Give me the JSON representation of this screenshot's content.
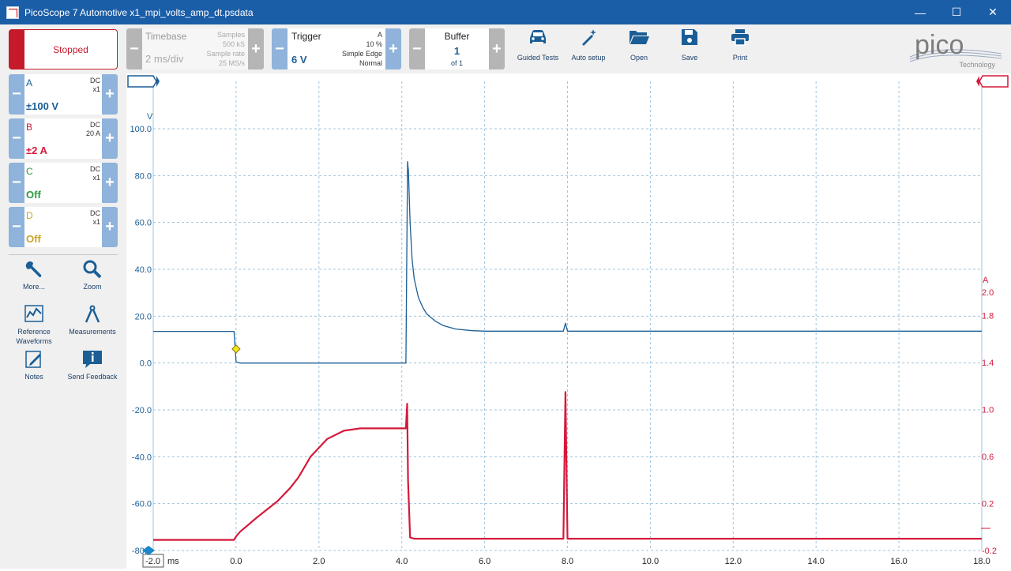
{
  "window": {
    "title": "PicoScope 7 Automotive x1_mpi_volts_amp_dt.psdata",
    "minimize": "—",
    "maximize": "☐",
    "close": "✕"
  },
  "run": {
    "status": "Stopped"
  },
  "timebase": {
    "label": "Timebase",
    "value": "2 ms/div",
    "samples_label": "Samples",
    "samples_value": "500 kS",
    "rate_label": "Sample rate",
    "rate_value": "25 MS/s"
  },
  "trigger": {
    "label": "Trigger",
    "value": "6 V",
    "channel": "A",
    "percent": "10 %",
    "type": "Simple Edge",
    "mode": "Normal"
  },
  "buffer": {
    "label": "Buffer",
    "value": "1",
    "of": "of 1"
  },
  "toolbar": {
    "guided": "Guided Tests",
    "autosetup": "Auto setup",
    "open": "Open",
    "save": "Save",
    "print": "Print"
  },
  "logo": {
    "main": "pico",
    "sub": "Technology"
  },
  "channels": [
    {
      "name": "A",
      "coupling": "DC",
      "probe": "x1",
      "range": "±100 V",
      "color": "#1b5e96"
    },
    {
      "name": "B",
      "coupling": "DC",
      "probe": "20 A",
      "range": "±2 A",
      "color": "#d41a3a"
    },
    {
      "name": "C",
      "coupling": "DC",
      "probe": "x1",
      "range": "Off",
      "color": "#2c9a3c"
    },
    {
      "name": "D",
      "coupling": "DC",
      "probe": "x1",
      "range": "Off",
      "color": "#c9a227"
    }
  ],
  "tools": {
    "more": "More...",
    "zoom": "Zoom",
    "reference": "Reference Waveforms",
    "measurements": "Measurements",
    "notes": "Notes",
    "feedback": "Send Feedback"
  },
  "chart_data": {
    "type": "line",
    "x_unit": "ms",
    "xlim": [
      -2.0,
      18.0
    ],
    "x_ticks": [
      "-2.0",
      "0.0",
      "2.0",
      "4.0",
      "6.0",
      "8.0",
      "10.0",
      "12.0",
      "14.0",
      "16.0",
      "18.0"
    ],
    "left_axis": {
      "unit": "V",
      "ylim": [
        -80,
        100
      ],
      "ticks": [
        "100.0",
        "80.0",
        "60.0",
        "40.0",
        "20.0",
        "0.0",
        "-20.0",
        "-40.0",
        "-60.0",
        "-80.0"
      ]
    },
    "right_axis": {
      "unit": "A",
      "ylim": [
        -0.2,
        2.0
      ],
      "ticks": [
        "2.0",
        "1.8",
        "1.4",
        "1.0",
        "0.6",
        "0.2",
        "-0.2"
      ]
    },
    "grid": true,
    "series": [
      {
        "name": "A",
        "axis": "left",
        "color": "#1b5e96",
        "x": [
          -2.0,
          -0.05,
          0.0,
          0.1,
          1.0,
          2.0,
          3.0,
          4.1,
          4.14,
          4.16,
          4.2,
          4.25,
          4.3,
          4.4,
          4.5,
          4.6,
          4.8,
          5.0,
          5.3,
          5.7,
          6.0,
          7.0,
          7.9,
          7.95,
          8.0,
          10.0,
          12.0,
          14.0,
          16.0,
          18.0
        ],
        "y": [
          13.5,
          13.5,
          0.5,
          0.0,
          0.0,
          0.0,
          0.0,
          0.0,
          86.0,
          82.0,
          60.0,
          44.0,
          36.0,
          28.0,
          24.0,
          21.0,
          18.0,
          16.0,
          14.5,
          13.8,
          13.6,
          13.6,
          13.6,
          17.0,
          13.6,
          13.6,
          13.6,
          13.6,
          13.6,
          13.6
        ]
      },
      {
        "name": "B",
        "axis": "right",
        "color": "#d41a3a",
        "x": [
          -2.0,
          -0.05,
          0.0,
          0.1,
          0.5,
          1.0,
          1.3,
          1.5,
          1.8,
          2.2,
          2.6,
          3.0,
          4.1,
          4.13,
          4.15,
          4.2,
          4.3,
          5.0,
          6.0,
          7.9,
          7.95,
          8.0,
          10.0,
          12.0,
          14.0,
          16.0,
          18.0
        ],
        "y": [
          -0.11,
          -0.11,
          -0.08,
          -0.04,
          0.08,
          0.22,
          0.33,
          0.42,
          0.6,
          0.75,
          0.82,
          0.84,
          0.84,
          1.05,
          0.4,
          -0.09,
          -0.1,
          -0.1,
          -0.1,
          -0.1,
          1.15,
          -0.1,
          -0.1,
          -0.1,
          -0.1,
          -0.1,
          -0.1
        ]
      }
    ]
  }
}
